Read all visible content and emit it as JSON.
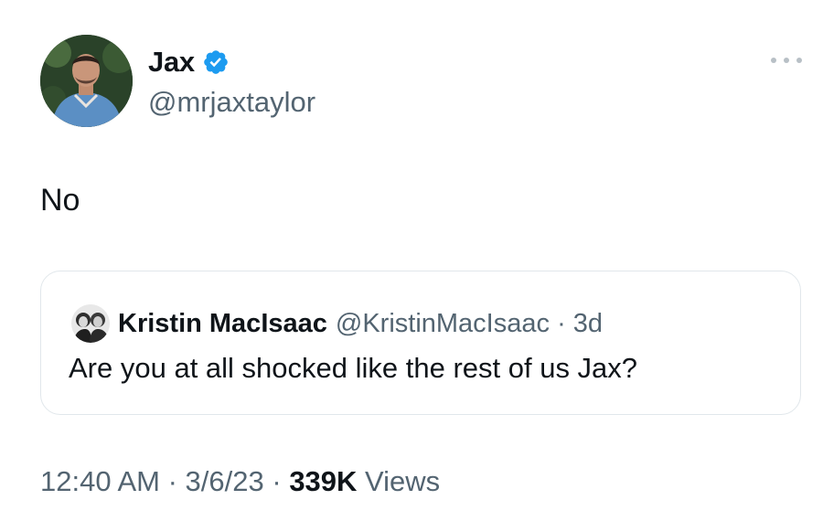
{
  "author": {
    "name": "Jax",
    "handle": "@mrjaxtaylor",
    "verified": true,
    "verified_color": "#1d9bf0"
  },
  "tweet": {
    "text": "No"
  },
  "quote": {
    "name": "Kristin MacIsaac",
    "handle": "@KristinMacIsaac",
    "separator": " · ",
    "age": "3d",
    "text": "Are you at all shocked like the rest of us Jax?"
  },
  "footer": {
    "time": "12:40 AM",
    "date": "3/6/23",
    "separator": " · ",
    "views_count": "339K",
    "views_label": "Views"
  },
  "icons": {
    "more": "more-horizontal-icon",
    "verified": "verified-badge-icon"
  }
}
